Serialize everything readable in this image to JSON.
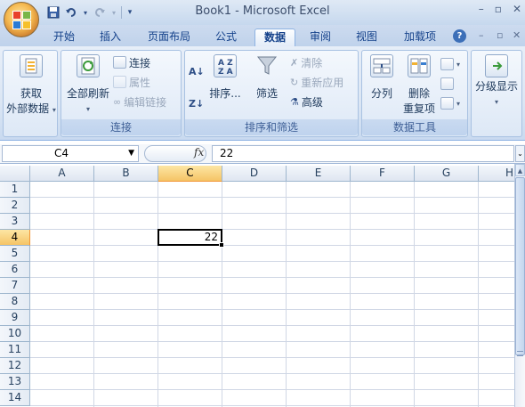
{
  "window": {
    "title": "Book1 - Microsoft Excel",
    "controls": {
      "minimize": "–",
      "restore": "▫",
      "close": "✕"
    }
  },
  "qat": {
    "save_icon": "save-icon",
    "undo_icon": "undo-icon",
    "redo_icon": "redo-icon",
    "customize_icon": "customize-icon"
  },
  "tabs": [
    {
      "label": "开始"
    },
    {
      "label": "插入"
    },
    {
      "label": "页面布局"
    },
    {
      "label": "公式"
    },
    {
      "label": "数据",
      "active": true
    },
    {
      "label": "审阅"
    },
    {
      "label": "视图"
    },
    {
      "label": "加载项"
    }
  ],
  "tab_controls": {
    "help": "?",
    "min": "–",
    "restore": "▫",
    "close": "✕"
  },
  "ribbon": {
    "groups": {
      "ext": {
        "label": "",
        "btn_line1": "获取",
        "btn_line2": "外部数据"
      },
      "connections": {
        "label": "连接",
        "refresh_all": "全部刷新",
        "connections": "连接",
        "properties": "属性",
        "edit_links": "编辑链接"
      },
      "sort_filter": {
        "label": "排序和筛选",
        "sort": "排序...",
        "filter": "筛选",
        "clear": "清除",
        "reapply": "重新应用",
        "advanced": "高级"
      },
      "data_tools": {
        "label": "数据工具",
        "text_to_columns": "分列",
        "remove_dup_1": "删除",
        "remove_dup_2": "重复项"
      },
      "outline": {
        "label": "分级显示"
      }
    }
  },
  "formula_bar": {
    "name_box": "C4",
    "fx": "fx",
    "content": "22"
  },
  "sheet": {
    "columns": [
      "A",
      "B",
      "C",
      "D",
      "E",
      "F",
      "G",
      "H"
    ],
    "rows": [
      "1",
      "2",
      "3",
      "4",
      "5",
      "6",
      "7",
      "8",
      "9",
      "10",
      "11",
      "12",
      "13",
      "14"
    ],
    "active_col": "C",
    "active_row": "4",
    "active_value": "22"
  }
}
